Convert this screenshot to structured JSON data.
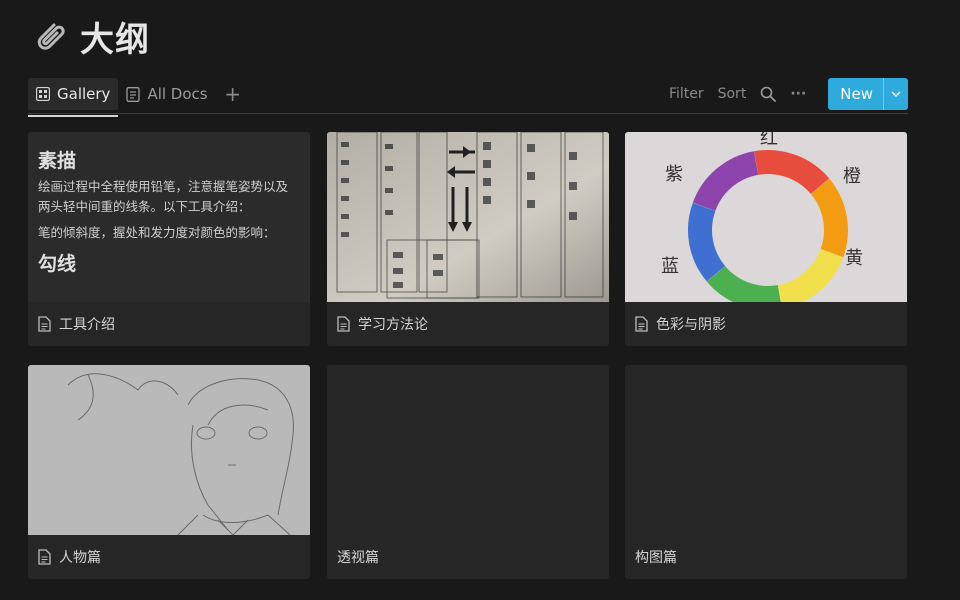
{
  "page": {
    "title": "大纲",
    "icon": "paperclip-icon"
  },
  "tabs": [
    {
      "label": "Gallery",
      "icon": "gallery-grid-icon",
      "active": true
    },
    {
      "label": "All Docs",
      "icon": "document-list-icon",
      "active": false
    }
  ],
  "toolbar": {
    "add_view": "+",
    "filter_label": "Filter",
    "sort_label": "Sort",
    "search_icon": "search-icon",
    "more_label": "···",
    "new_label": "New",
    "accent_color": "#2eaadc"
  },
  "cards": [
    {
      "title": "工具介绍",
      "cover_type": "text",
      "preview": {
        "heading1": "素描",
        "para1": "绘画过程中全程使用铅笔，注意握笔姿势以及两头轻中间重的线条。以下工具介绍：",
        "para2": "笔的倾斜度，握处和发力度对颜色的影响：",
        "heading2": "勾线"
      },
      "doc_icon": true
    },
    {
      "title": "学习方法论",
      "cover_type": "image",
      "doc_icon": true
    },
    {
      "title": "色彩与阴影",
      "cover_type": "image",
      "doc_icon": true,
      "cover_labels": {
        "top": "红",
        "left_top": "紫",
        "right_top": "橙",
        "left_bottom": "蓝",
        "right_bottom": "黄"
      }
    },
    {
      "title": "人物篇",
      "cover_type": "image",
      "doc_icon": true
    },
    {
      "title": "透视篇",
      "cover_type": "none",
      "doc_icon": false
    },
    {
      "title": "构图篇",
      "cover_type": "none",
      "doc_icon": false
    }
  ]
}
